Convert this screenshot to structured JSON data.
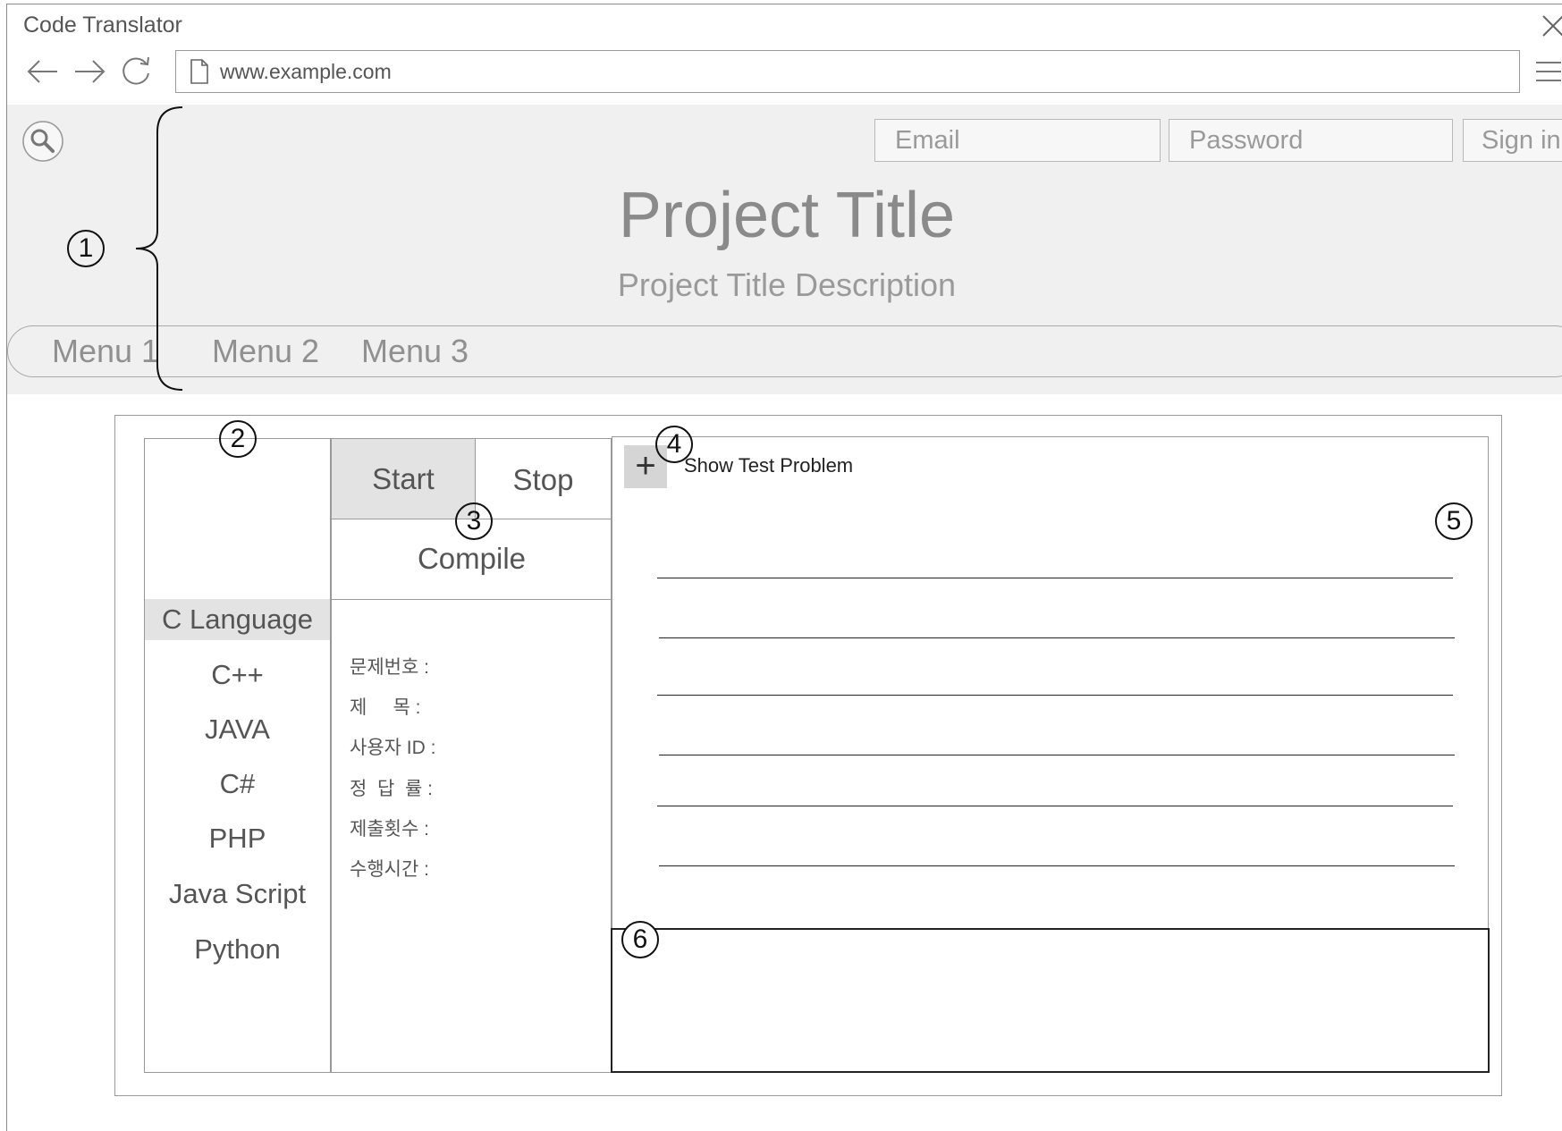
{
  "window": {
    "title": "Code Translator",
    "url": "www.example.com"
  },
  "icons": {
    "close": "close-icon",
    "back": "back-arrow-icon",
    "forward": "forward-arrow-icon",
    "reload": "reload-icon",
    "page": "page-icon",
    "menu": "hamburger-menu-icon",
    "search": "search-icon",
    "add": "plus-icon"
  },
  "header": {
    "email_placeholder": "Email",
    "password_placeholder": "Password",
    "signin_label": "Sign in",
    "title": "Project Title",
    "description": "Project Title Description",
    "menu": [
      "Menu 1",
      "Menu 2",
      "Menu 3"
    ]
  },
  "annotations": [
    "1",
    "2",
    "3",
    "4",
    "5",
    "6"
  ],
  "languages": {
    "items": [
      "C Language",
      "C++",
      "JAVA",
      "C#",
      "PHP",
      "Java Script",
      "Python"
    ],
    "selected": "C Language"
  },
  "controls": {
    "start": "Start",
    "stop": "Stop",
    "compile": "Compile"
  },
  "problem_info": [
    "문제번호 :",
    "제     목 :",
    "사용자 ID :",
    "정  답  률 :",
    "제출횟수 :",
    "수행시간 :"
  ],
  "problem": {
    "show_test_label": "Show Test Problem",
    "add_symbol": "+"
  },
  "colors": {
    "header_bg": "#f0f0f0",
    "selected_bg": "#e3e3e3",
    "button_bg": "#d5d5d5"
  }
}
